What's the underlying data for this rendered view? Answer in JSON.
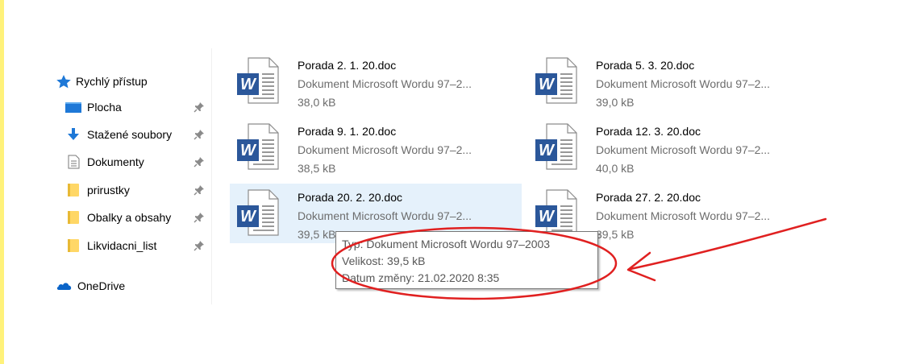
{
  "nav": {
    "quick_access": {
      "label": "Rychlý přístup",
      "icon": "star-icon"
    },
    "items": [
      {
        "label": "Plocha",
        "icon": "desktop-icon",
        "pinned": true
      },
      {
        "label": "Stažené soubory",
        "icon": "download-arrow-icon",
        "pinned": true
      },
      {
        "label": "Dokumenty",
        "icon": "documents-icon",
        "pinned": true
      },
      {
        "label": "prirustky",
        "icon": "folder-icon",
        "pinned": true
      },
      {
        "label": "Obalky a obsahy",
        "icon": "folder-icon",
        "pinned": true
      },
      {
        "label": "Likvidacni_list",
        "icon": "folder-icon",
        "pinned": true
      }
    ],
    "onedrive": {
      "label": "OneDrive",
      "icon": "cloud-icon"
    }
  },
  "files": [
    {
      "name": "Porada 2. 1. 20.doc",
      "type": "Dokument Microsoft Wordu 97–2...",
      "size": "38,0 kB",
      "selected": false
    },
    {
      "name": "Porada 5. 3. 20.doc",
      "type": "Dokument Microsoft Wordu 97–2...",
      "size": "39,0 kB",
      "selected": false
    },
    {
      "name": "Porada 9. 1. 20.doc",
      "type": "Dokument Microsoft Wordu 97–2...",
      "size": "38,5 kB",
      "selected": false
    },
    {
      "name": "Porada 12. 3. 20.doc",
      "type": "Dokument Microsoft Wordu 97–2...",
      "size": "40,0 kB",
      "selected": false
    },
    {
      "name": "Porada 20. 2. 20.doc",
      "type": "Dokument Microsoft Wordu 97–2...",
      "size": "39,5 kB",
      "selected": true
    },
    {
      "name": "Porada 27. 2. 20.doc",
      "type": "Dokument Microsoft Wordu 97–2...",
      "size": "39,5 kB",
      "selected": false
    }
  ],
  "tooltip": {
    "type_line": "Typ: Dokument Microsoft Wordu 97–2003",
    "size_line": "Velikost: 39,5 kB",
    "date_line": "Datum změny: 21.02.2020 8:35"
  },
  "colors": {
    "selection_bg": "#e5f1fb",
    "word_blue": "#2b579a",
    "annotation_red": "#e02020",
    "folder_yellow": "#ffd766",
    "accent_blue": "#1e78d7"
  }
}
